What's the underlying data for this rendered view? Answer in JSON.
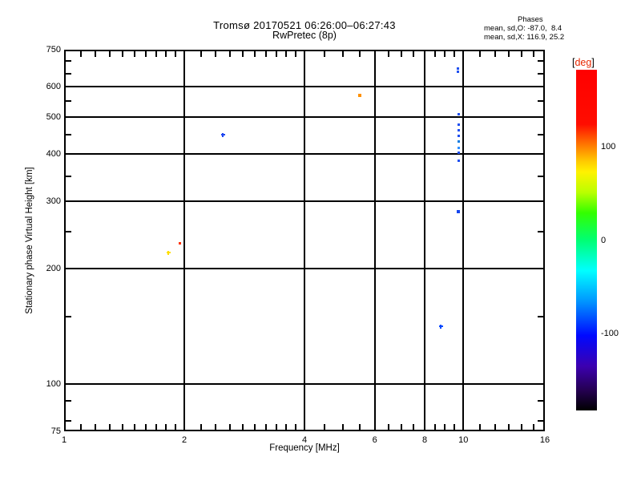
{
  "header": {
    "title": "Tromsø 20170521 06:26:00–06:27:43",
    "subtitle": "RwPretec (8p)",
    "stats_title": "Phases",
    "stats_o": "mean, sd,O: -87.0,  8.4",
    "stats_x": "mean, sd,X: 116.9, 25.2"
  },
  "axes": {
    "x_label": "Frequency [MHz]",
    "y_label": "Stationary phase Virtual Height [km]",
    "x_scale": "log",
    "y_scale": "log",
    "x_range": [
      1,
      16
    ],
    "y_range": [
      75,
      750
    ],
    "x_ticks_labeled": [
      1,
      2,
      4,
      6,
      8,
      10,
      16
    ],
    "x_gridlines": [
      2,
      4,
      6,
      8,
      10
    ],
    "x_minor_ticks": [
      1.1,
      1.2,
      1.3,
      1.4,
      1.5,
      1.6,
      1.7,
      1.8,
      1.9,
      2.2,
      2.4,
      2.6,
      2.8,
      3.0,
      3.2,
      3.4,
      3.6,
      3.8,
      4.5,
      5,
      5.5,
      6.5,
      7,
      7.5,
      8.5,
      9,
      9.5,
      11,
      12,
      13,
      14,
      15
    ],
    "y_ticks_labeled": [
      75,
      100,
      200,
      300,
      400,
      500,
      600,
      750
    ],
    "y_gridlines": [
      100,
      200,
      300,
      400,
      500,
      600
    ],
    "y_minor_ticks": [
      80,
      90,
      150,
      250,
      350,
      450,
      550,
      650,
      700
    ]
  },
  "chart_data": {
    "type": "scatter",
    "title": "Tromsø 20170521 06:26:00–06:27:43  RwPretec (8p)",
    "xlabel": "Frequency [MHz]",
    "ylabel": "Stationary phase Virtual Height [km]",
    "x_range": [
      1,
      16
    ],
    "y_range": [
      75,
      750
    ],
    "log_x": true,
    "log_y": true,
    "grid": true,
    "color_encodes": "phase [deg]",
    "points": [
      {
        "f_mhz": 1.83,
        "h_km": 220,
        "phase_deg": 105,
        "color": "#ffdf00",
        "size": 5,
        "shape": "plus"
      },
      {
        "f_mhz": 1.95,
        "h_km": 233,
        "phase_deg": 150,
        "color": "#ff3000",
        "size": 3,
        "shape": "dot"
      },
      {
        "f_mhz": 2.5,
        "h_km": 449,
        "phase_deg": -87,
        "color": "#1e46f0",
        "size": 5,
        "shape": "plus"
      },
      {
        "f_mhz": 5.5,
        "h_km": 569,
        "phase_deg": 130,
        "color": "#ff9000",
        "size": 4,
        "shape": "dot"
      },
      {
        "f_mhz": 9.7,
        "h_km": 670,
        "phase_deg": -87,
        "color": "#2050f0",
        "size": 3,
        "shape": "dot"
      },
      {
        "f_mhz": 9.7,
        "h_km": 656,
        "phase_deg": -87,
        "color": "#2050f0",
        "size": 3,
        "shape": "dot"
      },
      {
        "f_mhz": 9.72,
        "h_km": 509,
        "phase_deg": -87,
        "color": "#2050f0",
        "size": 3,
        "shape": "dot"
      },
      {
        "f_mhz": 9.72,
        "h_km": 478,
        "phase_deg": -87,
        "color": "#2050f0",
        "size": 3,
        "shape": "dot"
      },
      {
        "f_mhz": 9.72,
        "h_km": 462,
        "phase_deg": -87,
        "color": "#2050f0",
        "size": 3,
        "shape": "dot"
      },
      {
        "f_mhz": 9.72,
        "h_km": 445,
        "phase_deg": -87,
        "color": "#2050f0",
        "size": 3,
        "shape": "dot"
      },
      {
        "f_mhz": 9.72,
        "h_km": 430,
        "phase_deg": -75,
        "color": "#0f7ae0",
        "size": 3,
        "shape": "dot"
      },
      {
        "f_mhz": 9.72,
        "h_km": 414,
        "phase_deg": -70,
        "color": "#2f8fff",
        "size": 3,
        "shape": "dot"
      },
      {
        "f_mhz": 9.72,
        "h_km": 403,
        "phase_deg": -87,
        "color": "#2050f0",
        "size": 3,
        "shape": "dot"
      },
      {
        "f_mhz": 9.72,
        "h_km": 383,
        "phase_deg": -87,
        "color": "#2050f0",
        "size": 3,
        "shape": "dot"
      },
      {
        "f_mhz": 9.7,
        "h_km": 282,
        "phase_deg": -87,
        "color": "#1545ee",
        "size": 4,
        "shape": "dot"
      },
      {
        "f_mhz": 8.8,
        "h_km": 141,
        "phase_deg": -90,
        "color": "#0048ff",
        "size": 5,
        "shape": "plus"
      }
    ]
  },
  "colorbar": {
    "bracket_left": "[",
    "title_text": "deg",
    "bracket_right": "]",
    "title_color": "#e82600",
    "range": [
      -183,
      183
    ],
    "labels": [
      {
        "value": 100,
        "text": "100"
      },
      {
        "value": 0,
        "text": "0"
      },
      {
        "value": -100,
        "text": "-100"
      }
    ],
    "gradient_stops": [
      [
        "0%",
        "#ff0000"
      ],
      [
        "16%",
        "#ff0d00"
      ],
      [
        "21%",
        "#ff6600"
      ],
      [
        "27%",
        "#ffcc00"
      ],
      [
        "30%",
        "#fff200"
      ],
      [
        "36%",
        "#baff00"
      ],
      [
        "42%",
        "#33ff00"
      ],
      [
        "50%",
        "#00ff73"
      ],
      [
        "59%",
        "#00ffff"
      ],
      [
        "68%",
        "#0095ff"
      ],
      [
        "78%",
        "#0009ff"
      ],
      [
        "87%",
        "#3c00b0"
      ],
      [
        "94%",
        "#250052"
      ],
      [
        "100%",
        "#000000"
      ]
    ]
  }
}
